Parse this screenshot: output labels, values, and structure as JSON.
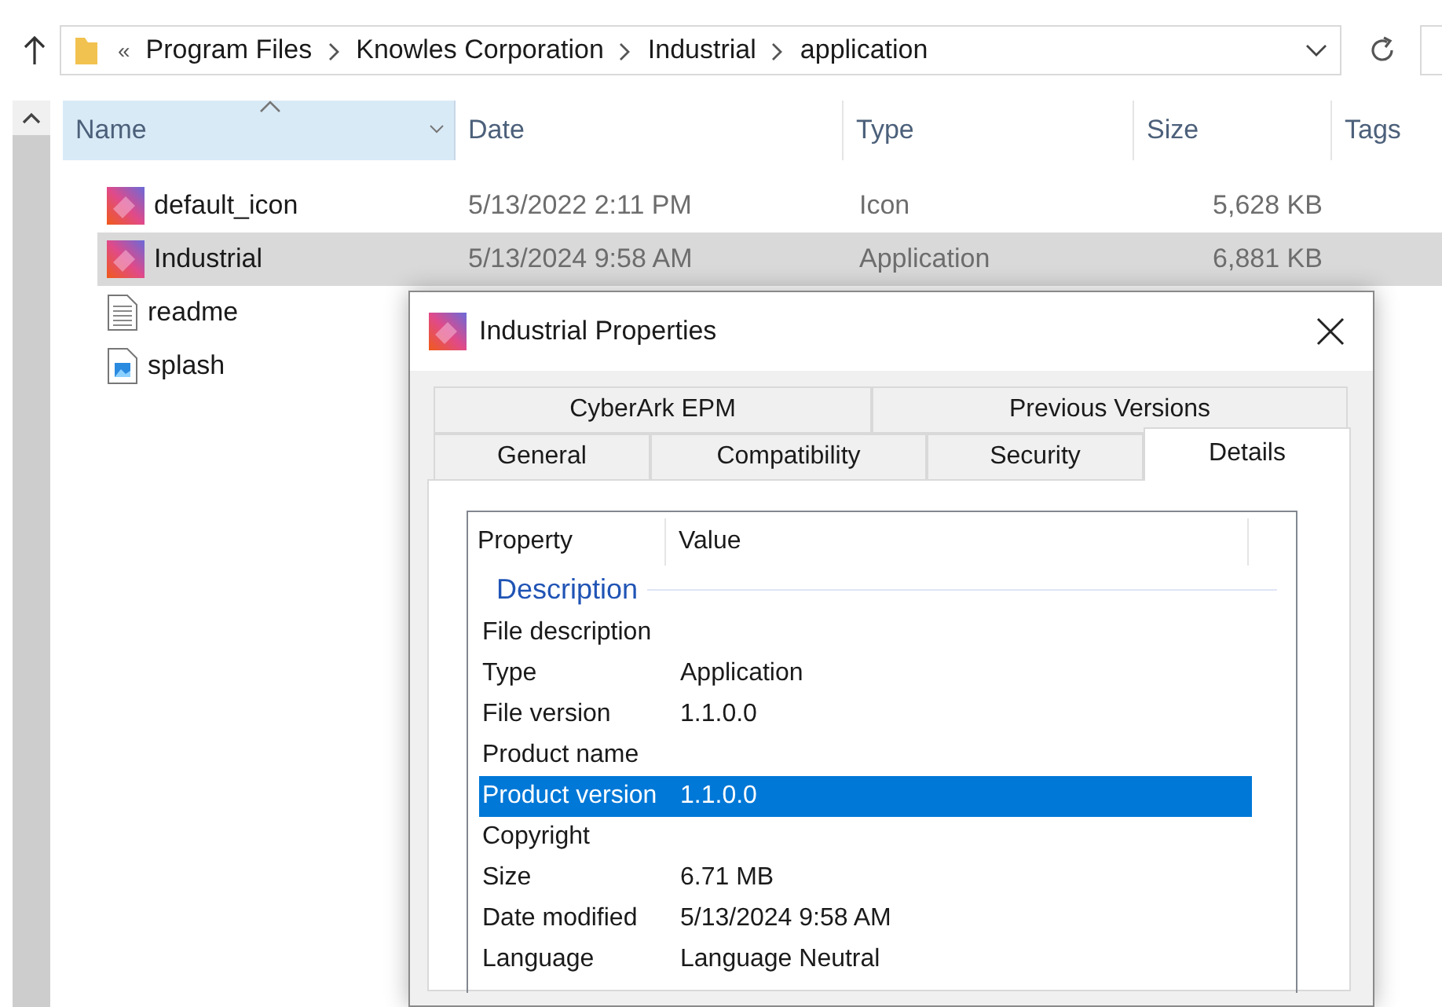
{
  "explorer": {
    "breadcrumb_overflow": "«",
    "breadcrumbs": [
      "Program Files",
      "Knowles Corporation",
      "Industrial",
      "application"
    ],
    "columns": [
      {
        "label": "Name",
        "sorted": true
      },
      {
        "label": "Date",
        "sorted": false
      },
      {
        "label": "Type",
        "sorted": false
      },
      {
        "label": "Size",
        "sorted": false
      },
      {
        "label": "Tags",
        "sorted": false
      }
    ],
    "files": [
      {
        "kind": "image",
        "name": "default_icon",
        "date": "5/13/2022 2:11 PM",
        "type": "Icon",
        "size": "5,628 KB",
        "selected": false
      },
      {
        "kind": "image",
        "name": "Industrial",
        "date": "5/13/2024 9:58 AM",
        "type": "Application",
        "size": "6,881 KB",
        "selected": true
      },
      {
        "kind": "text",
        "name": "readme",
        "selected": false
      },
      {
        "kind": "picture-file",
        "name": "splash",
        "selected": false
      }
    ]
  },
  "dialog": {
    "title": "Industrial Properties",
    "tab_rows": [
      [
        {
          "label": "CyberArk EPM",
          "selected": false
        },
        {
          "label": "Previous Versions",
          "selected": false
        }
      ],
      [
        {
          "label": "General",
          "selected": false
        },
        {
          "label": "Compatibility",
          "selected": false
        },
        {
          "label": "Security",
          "selected": false
        },
        {
          "label": "Details",
          "selected": true
        }
      ]
    ],
    "details": {
      "columns": [
        "Property",
        "Value"
      ],
      "group": "Description",
      "rows": [
        {
          "property": "File description",
          "value": "",
          "selected": false
        },
        {
          "property": "Type",
          "value": "Application",
          "selected": false
        },
        {
          "property": "File version",
          "value": "1.1.0.0",
          "selected": false
        },
        {
          "property": "Product name",
          "value": "",
          "selected": false
        },
        {
          "property": "Product version",
          "value": "1.1.0.0",
          "selected": true
        },
        {
          "property": "Copyright",
          "value": "",
          "selected": false
        },
        {
          "property": "Size",
          "value": "6.71 MB",
          "selected": false
        },
        {
          "property": "Date modified",
          "value": "5/13/2024 9:58 AM",
          "selected": false
        },
        {
          "property": "Language",
          "value": "Language Neutral",
          "selected": false
        }
      ]
    }
  }
}
